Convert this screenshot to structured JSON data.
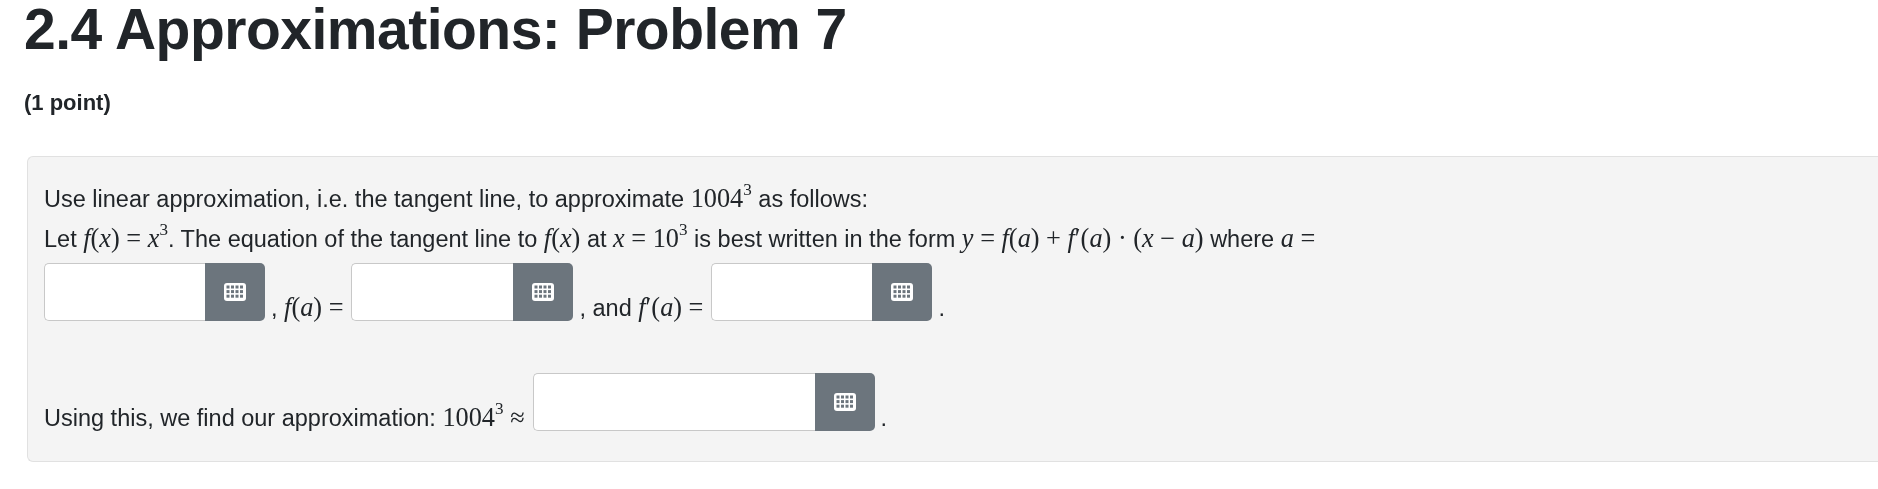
{
  "title": "2.4 Approximations: Problem 7",
  "points": "(1 point)",
  "lines": [
    [
      {
        "kind": "text",
        "text": "Use linear approximation, i.e. the tangent line, to approximate "
      },
      {
        "kind": "math",
        "text": "1004$^{3}$"
      },
      {
        "kind": "text",
        "text": " as follows:"
      }
    ],
    [
      {
        "kind": "text",
        "text": "Let "
      },
      {
        "kind": "math",
        "text": "*f*(*x*) = *x*$^{3}$"
      },
      {
        "kind": "text",
        "text": ". The equation of the tangent line to "
      },
      {
        "kind": "math",
        "text": "*f*(*x*)"
      },
      {
        "kind": "text",
        "text": " at "
      },
      {
        "kind": "math",
        "text": "*x* = 10$^{3}$"
      },
      {
        "kind": "text",
        "text": " is best written in the form "
      },
      {
        "kind": "math",
        "text": "*y* = *f*(*a*) + *f*′(*a*) · (*x* − *a*)"
      },
      {
        "kind": "text",
        "text": " where "
      },
      {
        "kind": "math",
        "text": "*a* ="
      }
    ]
  ],
  "answer_rows": [
    [
      {
        "kind": "field"
      },
      {
        "kind": "label",
        "parts": [
          {
            "kind": "text",
            "text": ", "
          },
          {
            "kind": "math",
            "text": "*f*(*a*) ="
          }
        ]
      },
      {
        "kind": "field"
      },
      {
        "kind": "label",
        "parts": [
          {
            "kind": "text",
            "text": ", and "
          },
          {
            "kind": "math",
            "text": "*f*′(*a*) ="
          }
        ]
      },
      {
        "kind": "field"
      },
      {
        "kind": "label",
        "parts": [
          {
            "kind": "text",
            "text": "."
          }
        ]
      }
    ],
    [
      {
        "kind": "label",
        "parts": [
          {
            "kind": "text",
            "text": "Using this, we find our approximation: "
          },
          {
            "kind": "math",
            "text": "1004$^{3}$ ≈"
          }
        ]
      },
      {
        "kind": "field"
      },
      {
        "kind": "label",
        "parts": [
          {
            "kind": "text",
            "text": "."
          }
        ]
      }
    ]
  ]
}
